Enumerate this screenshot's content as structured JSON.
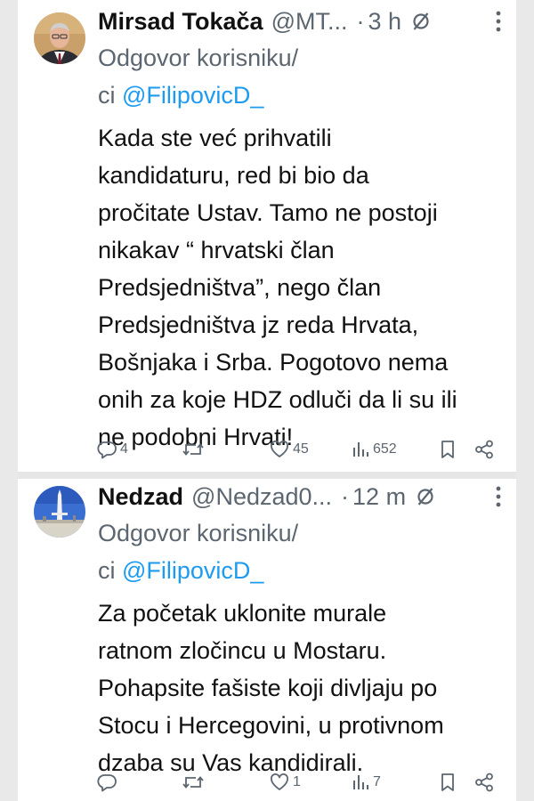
{
  "tweets": [
    {
      "display_name": "Mirsad Tokača",
      "handle": "@MT...",
      "time": "3 h",
      "reply_prefix": "Odgovor korisniku/",
      "reply_line2_prefix": "ci ",
      "reply_mention": "@FilipovicD_",
      "text": "Kada ste već prihvatili\nkandidaturu, red bi bio da\npročitate Ustav. Tamo ne postoji\nnikakav “ hrvatski član\nPredsjedništva”, nego član\nPredsjedništva jz reda Hrvata,\nBošnjaka i Srba. Pogotovo nema\nonih za koje HDZ odluči da li su ili\nne podobni Hrvati!",
      "replies": "4",
      "retweets": "",
      "likes": "45",
      "views": "652",
      "avatar_icon": "man-portrait-avatar"
    },
    {
      "display_name": "Nedzad",
      "handle": "@Nedzad0...",
      "time": "12 m",
      "reply_prefix": "Odgovor korisniku/",
      "reply_line2_prefix": "ci ",
      "reply_mention": "@FilipovicD_",
      "text": "Za početak uklonite murale\nratnom zločincu u Mostaru.\nPohapsite fašiste koji divljaju po\nStocu i Hercegovini, u protivnom\ndzaba su Vas kandidirali.",
      "replies": "",
      "retweets": "",
      "likes": "1",
      "views": "7",
      "avatar_icon": "monument-sky-avatar"
    }
  ],
  "time_separator": "·",
  "colors": {
    "text": "#111111",
    "muted": "#5c6670",
    "link": "#1d9bf0",
    "background": "#ffffff",
    "page_margin": "#e9e9e9"
  }
}
